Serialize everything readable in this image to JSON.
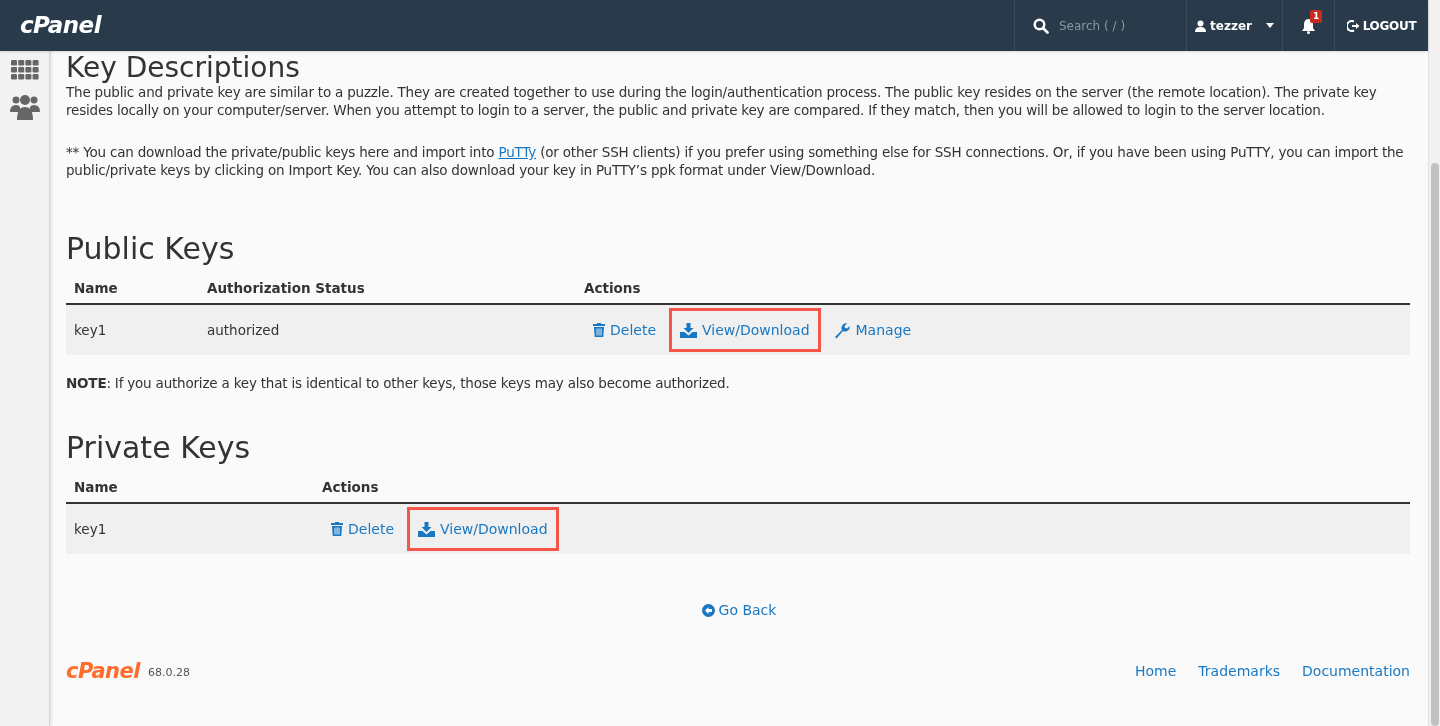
{
  "header": {
    "logo": "cPanel",
    "search": {
      "placeholder": "Search ( / )"
    },
    "user": "tezzer",
    "notifications": "1",
    "logout": "LOGOUT"
  },
  "sidebar": {
    "items": [
      {
        "kind": "grid"
      },
      {
        "kind": "users"
      }
    ]
  },
  "key_descriptions": {
    "title": "Key Descriptions",
    "paragraph": "The public and private key are similar to a puzzle. They are created together to use during the login/authentication process. The public key resides on the server (the remote location). The private key resides locally on your computer/server. When you attempt to login to a server, the public and private key are compared. If they match, then you will be allowed to login to the server location.",
    "note_before": "** You can download the private/public keys here and import into",
    "note_link": "PuTTy",
    "note_after": "(or other SSH clients) if you prefer using something else for SSH connections. Or, if you have been using PuTTY, you can import the public/private keys by clicking on Import Key. You can also download your key in PuTTY’s ppk format under View/Download."
  },
  "public_keys": {
    "title": "Public Keys",
    "columns": [
      "Name",
      "Authorization Status",
      "Actions"
    ],
    "rows": [
      {
        "name": "key1",
        "status": "authorized",
        "actions": [
          {
            "kind": "delete",
            "label": "Delete",
            "highlighted": false
          },
          {
            "kind": "download",
            "label": "View/Download",
            "highlighted": true
          },
          {
            "kind": "manage",
            "label": "Manage",
            "highlighted": false
          }
        ]
      }
    ],
    "note": "**NOTE**: If you authorize a key that is identical to other keys, those keys may also become authorized."
  },
  "private_keys": {
    "title": "Private Keys",
    "columns": [
      "Name",
      "Actions"
    ],
    "rows": [
      {
        "name": "key1",
        "actions": [
          {
            "kind": "delete",
            "label": "Delete",
            "highlighted": false
          },
          {
            "kind": "download",
            "label": "View/Download",
            "highlighted": true
          }
        ]
      }
    ]
  },
  "go_back": "Go Back",
  "footer": {
    "logo": "cPanel",
    "version": "68.0.28",
    "links": [
      "Home",
      "Trademarks",
      "Documentation"
    ]
  }
}
